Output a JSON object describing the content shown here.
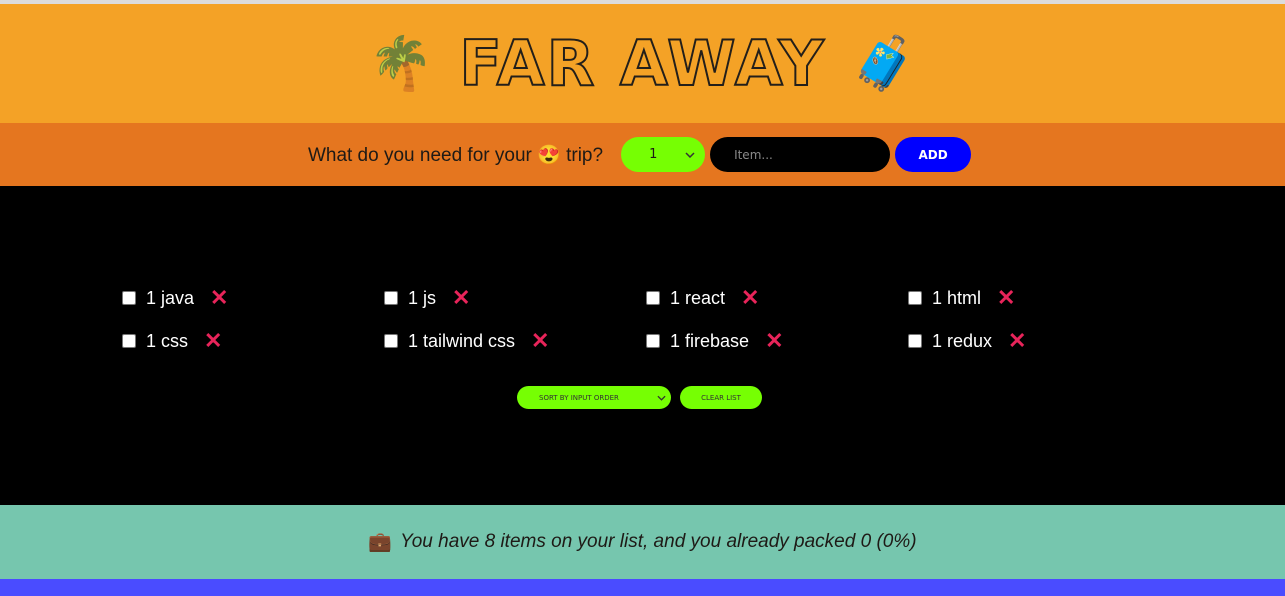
{
  "header": {
    "title": "FAR AWAY",
    "left_icon": "🌴",
    "right_icon": "🧳"
  },
  "form": {
    "question_prefix": "What do you need for your",
    "question_emoji": "😍",
    "question_suffix": "trip?",
    "quantity": "1",
    "item_placeholder": "Item...",
    "add_label": "ADD"
  },
  "items": [
    {
      "label": "1 java"
    },
    {
      "label": "1 js"
    },
    {
      "label": "1 react"
    },
    {
      "label": "1 html"
    },
    {
      "label": "1 css"
    },
    {
      "label": "1 tailwind css"
    },
    {
      "label": "1 firebase"
    },
    {
      "label": "1 redux"
    }
  ],
  "delete_glyph": "✕",
  "actions": {
    "sort_label": "SORT BY INPUT ORDER",
    "clear_label": "CLEAR LIST"
  },
  "stats": {
    "icon": "💼",
    "text": "You have 8 items on your list, and you already packed 0 (0%)"
  },
  "colors": {
    "header": "#f4a226",
    "form": "#e5761f",
    "accent_green": "#76ff03",
    "add_button": "#0000ff",
    "delete": "#e8245a",
    "footer": "#76c6ae"
  }
}
